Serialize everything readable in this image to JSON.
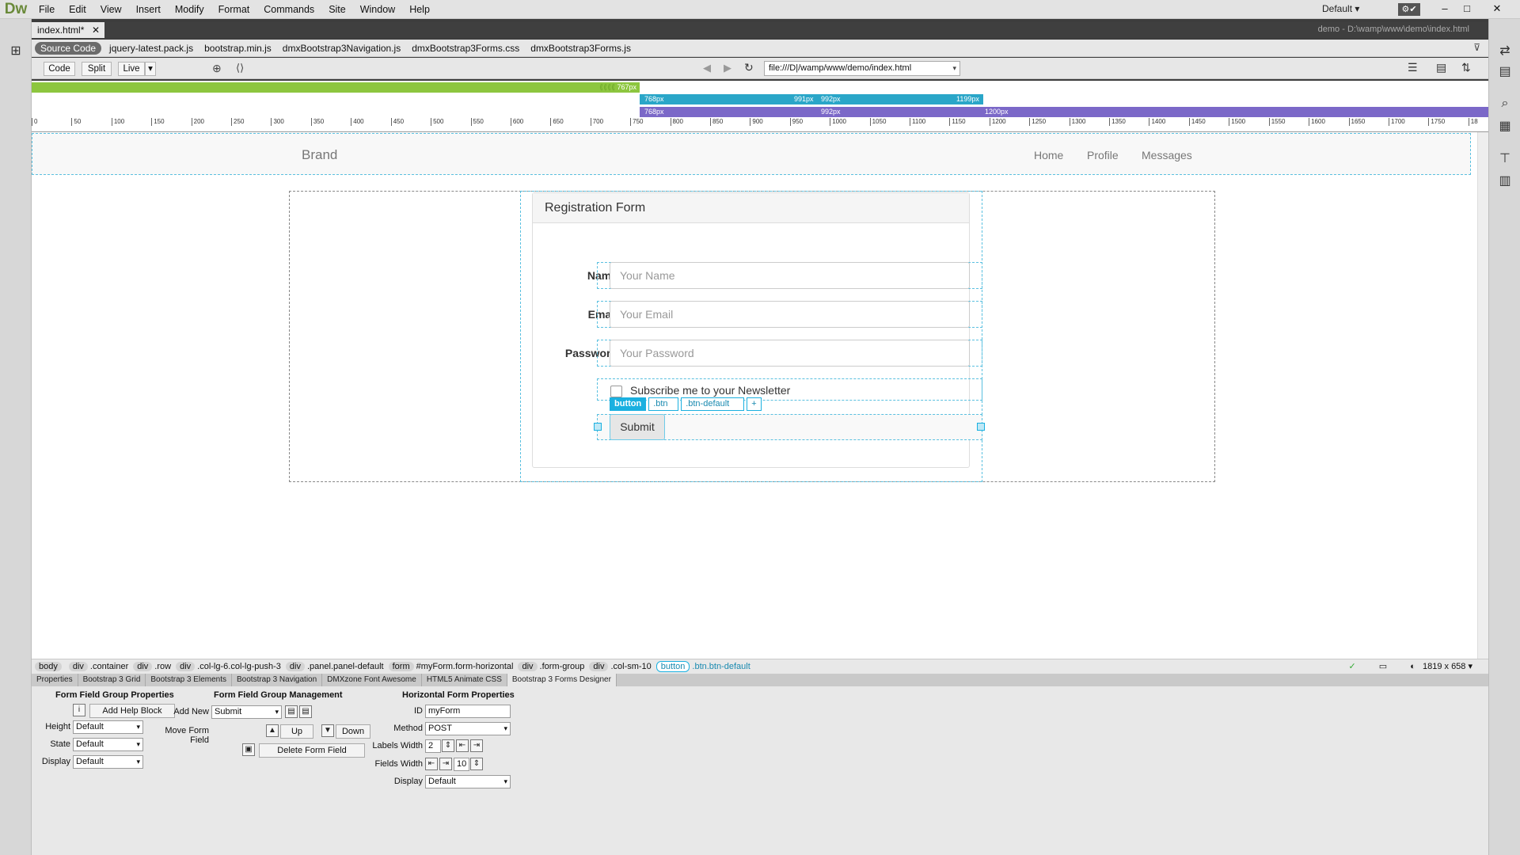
{
  "app": {
    "logo": "Dw"
  },
  "menu": [
    "File",
    "Edit",
    "View",
    "Insert",
    "Modify",
    "Format",
    "Commands",
    "Site",
    "Window",
    "Help"
  ],
  "workspace": "Default",
  "document": {
    "tab": "index.html*",
    "path": "demo - D:\\wamp\\www\\demo\\index.html"
  },
  "related_files": [
    "Source Code",
    "jquery-latest.pack.js",
    "bootstrap.min.js",
    "dmxBootstrap3Navigation.js",
    "dmxBootstrap3Forms.css",
    "dmxBootstrap3Forms.js"
  ],
  "toolbar": {
    "code": "Code",
    "split": "Split",
    "live": "Live",
    "address": "file:///D|/wamp/www/demo/index.html"
  },
  "media_queries": {
    "bar1_end": "767px",
    "bar2_start": "768px",
    "bar2_mid_end": "991px",
    "bar2_mid_start": "992px",
    "bar2_end": "1199px",
    "bar3_start": "768px",
    "bar3_mid": "992px",
    "bar3_end": "1200px"
  },
  "ruler": [
    "0",
    "50",
    "100",
    "150",
    "200",
    "250",
    "300",
    "350",
    "400",
    "450",
    "500",
    "550",
    "600",
    "650",
    "700",
    "750",
    "800",
    "850",
    "900",
    "950",
    "1000",
    "1050",
    "1100",
    "1150",
    "1200",
    "1250",
    "1300",
    "1350",
    "1400",
    "1450",
    "1500",
    "1550",
    "1600",
    "1650",
    "1700",
    "1750",
    "18"
  ],
  "navbar": {
    "brand": "Brand",
    "links": [
      "Home",
      "Profile",
      "Messages"
    ]
  },
  "form": {
    "title": "Registration Form",
    "fields": [
      {
        "label": "Name",
        "placeholder": "Your Name"
      },
      {
        "label": "Email",
        "placeholder": "Your Email"
      },
      {
        "label": "Password",
        "placeholder": "Your Password"
      }
    ],
    "checkbox": "Subscribe me to your Newsletter",
    "selector": {
      "tag": "button",
      "classes": [
        ".btn",
        ".btn-default"
      ],
      "add": "+"
    },
    "submit": "Submit"
  },
  "tag_selector": [
    {
      "tag": "body",
      "cls": ""
    },
    {
      "tag": "div",
      "cls": ".container"
    },
    {
      "tag": "div",
      "cls": ".row"
    },
    {
      "tag": "div",
      "cls": ".col-lg-6.col-lg-push-3"
    },
    {
      "tag": "div",
      "cls": ".panel.panel-default"
    },
    {
      "tag": "form",
      "cls": "#myForm.form-horizontal"
    },
    {
      "tag": "div",
      "cls": ".form-group"
    },
    {
      "tag": "div",
      "cls": ".col-sm-10"
    },
    {
      "tag": "button",
      "cls": ".btn.btn-default"
    }
  ],
  "status": {
    "size": "1819 x 658"
  },
  "panel_tabs": [
    "Properties",
    "Bootstrap 3 Grid",
    "Bootstrap 3 Elements",
    "Bootstrap 3 Navigation",
    "DMXzone Font Awesome",
    "HTML5 Animate CSS",
    "Bootstrap 3 Forms Designer"
  ],
  "props": {
    "group1": {
      "title": "Form Field Group Properties",
      "add_help": "Add Help Block",
      "height_label": "Height",
      "height": "Default",
      "state_label": "State",
      "state": "Default",
      "display_label": "Display",
      "display": "Default"
    },
    "group2": {
      "title": "Form Field Group Management",
      "add_new_label": "Add New",
      "add_new": "Submit",
      "move_label": "Move Form Field",
      "up": "Up",
      "down": "Down",
      "delete": "Delete Form Field"
    },
    "group3": {
      "title": "Horizontal Form Properties",
      "id_label": "ID",
      "id": "myForm",
      "method_label": "Method",
      "method": "POST",
      "labels_width_label": "Labels Width",
      "labels_width": "2",
      "fields_width_label": "Fields Width",
      "fields_width": "10",
      "display_label": "Display",
      "display": "Default"
    }
  },
  "colors": {
    "accent": "#1ab0e0",
    "mq_green": "#8dc63f",
    "mq_blue": "#2aa6c8",
    "mq_purple": "#7b68c8"
  }
}
